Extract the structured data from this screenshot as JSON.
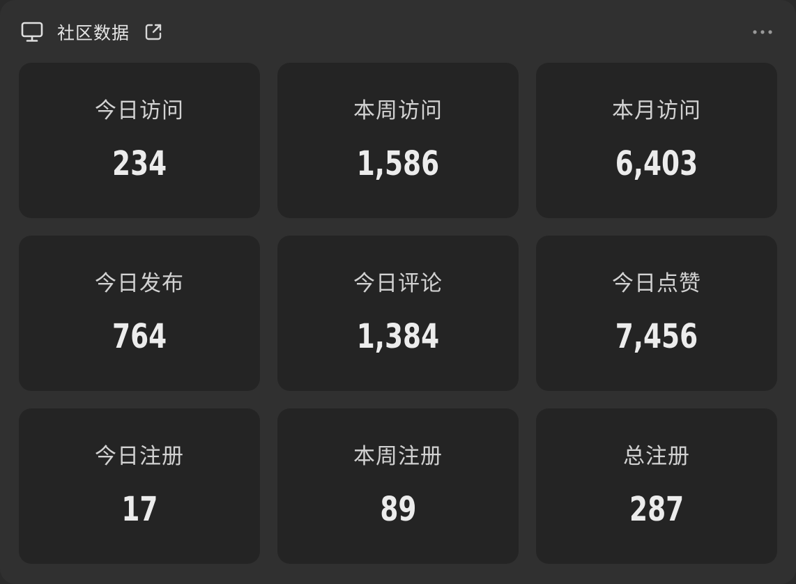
{
  "header": {
    "title": "社区数据",
    "icons": [
      "monitor-icon",
      "external-link-icon",
      "more-icon"
    ]
  },
  "stats": [
    {
      "label": "今日访问",
      "value": "234"
    },
    {
      "label": "本周访问",
      "value": "1,586"
    },
    {
      "label": "本月访问",
      "value": "6,403"
    },
    {
      "label": "今日发布",
      "value": "764"
    },
    {
      "label": "今日评论",
      "value": "1,384"
    },
    {
      "label": "今日点赞",
      "value": "7,456"
    },
    {
      "label": "今日注册",
      "value": "17"
    },
    {
      "label": "本周注册",
      "value": "89"
    },
    {
      "label": "总注册",
      "value": "287"
    }
  ],
  "colors": {
    "panel_background": "#303030",
    "card_background": "#242424",
    "label_text": "#d2d2d2",
    "value_text": "#ececec"
  }
}
